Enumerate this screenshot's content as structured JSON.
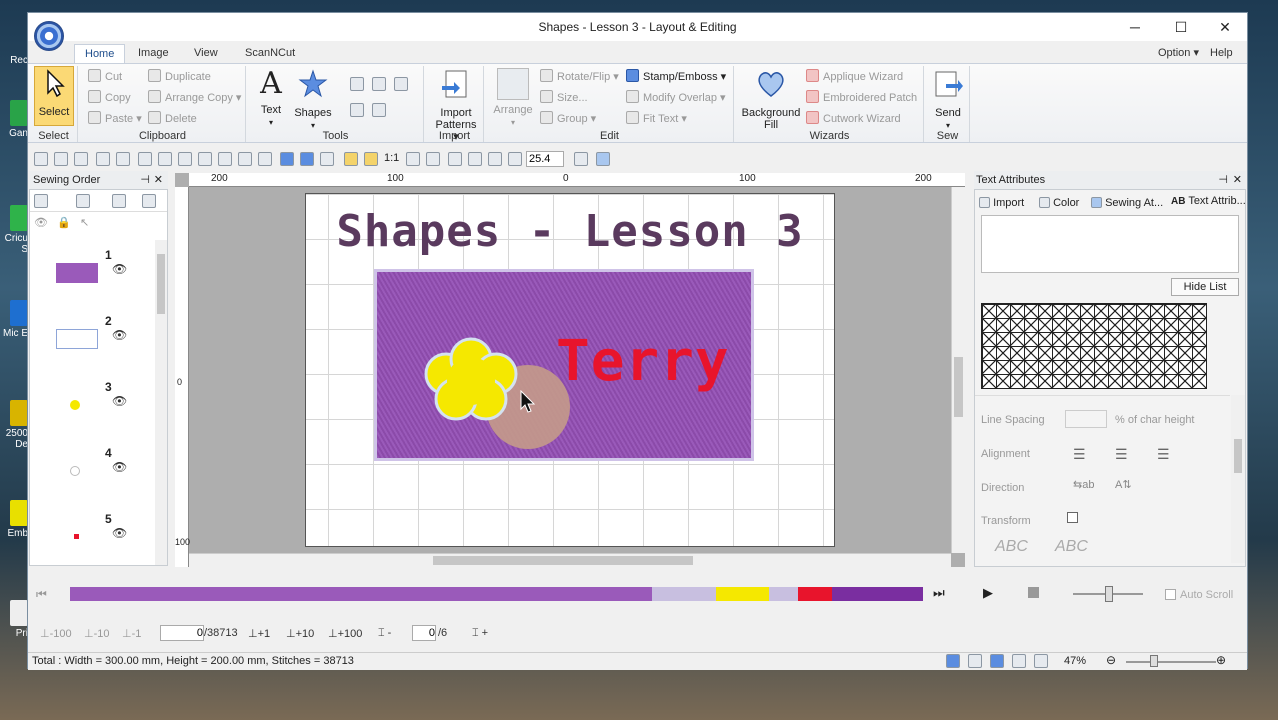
{
  "window": {
    "title": "Shapes - Lesson 3 - Layout & Editing",
    "minimize": "─",
    "maximize": "☐",
    "close": "✕"
  },
  "menu": {
    "tabs": [
      "Home",
      "Image",
      "View",
      "ScanNCut"
    ],
    "active_tab": "Home",
    "option": "Option",
    "help": "Help"
  },
  "ribbon": {
    "select": {
      "label": "Select",
      "group": "Select"
    },
    "clipboard": {
      "group": "Clipboard",
      "cut": "Cut",
      "copy": "Copy",
      "paste": "Paste",
      "duplicate": "Duplicate",
      "arrange_copy": "Arrange Copy",
      "delete": "Delete"
    },
    "tools": {
      "group": "Tools",
      "text": "Text",
      "shapes": "Shapes"
    },
    "import": {
      "group": "Import",
      "import_patterns": "Import Patterns"
    },
    "edit": {
      "group": "Edit",
      "arrange": "Arrange",
      "rotate_flip": "Rotate/Flip",
      "size": "Size...",
      "group_btn": "Group",
      "stamp_emboss": "Stamp/Emboss",
      "modify_overlap": "Modify Overlap",
      "fit_text": "Fit Text"
    },
    "wizards": {
      "group": "Wizards",
      "background_fill": "Background Fill",
      "applique_wizard": "Applique Wizard",
      "embroidered_patch": "Embroidered Patch",
      "cutwork_wizard": "Cutwork Wizard"
    },
    "sew": {
      "group": "Sew",
      "send": "Send"
    }
  },
  "toolbar": {
    "zoom_value": "25.4",
    "ratio": "1:1"
  },
  "sewing_order": {
    "title": "Sewing Order",
    "items": [
      {
        "num": "1",
        "color": "#9a5aba"
      },
      {
        "num": "2",
        "color": "#ffffff"
      },
      {
        "num": "3",
        "color": "#f5e800"
      },
      {
        "num": "4",
        "color": "#ffffff"
      },
      {
        "num": "5",
        "color": "#e8142c"
      }
    ]
  },
  "canvas": {
    "ruler_top": [
      "200",
      "100",
      "0",
      "100",
      "200"
    ],
    "ruler_left": [
      "0",
      "100"
    ],
    "design_title": "Shapes - Lesson 3",
    "name_text": "Terry"
  },
  "text_attributes": {
    "title": "Text Attributes",
    "tabs": [
      "Import",
      "Color",
      "Sewing At...",
      "Text Attrib..."
    ],
    "hide_list": "Hide List",
    "line_spacing_label": "Line Spacing",
    "char_height_label": "% of char height",
    "alignment_label": "Alignment",
    "direction_label": "Direction",
    "transform_label": "Transform"
  },
  "sequence": {
    "colors": [
      "#9a5aba",
      "#c8bfe0",
      "#f5e800",
      "#c8bfe0",
      "#e8142c",
      "#7a2ea0"
    ],
    "auto_scroll": "Auto Scroll"
  },
  "stitch_nav": {
    "minus100": "-100",
    "minus10": "-10",
    "minus1": "-1",
    "stitch_pos": "0",
    "stitch_total": "/38713",
    "plus1": "+1",
    "plus10": "+10",
    "plus100": "+100",
    "color_pos": "0",
    "color_total": "/6"
  },
  "status": {
    "text": "Total : Width = 300.00 mm, Height = 200.00 mm, Stitches = 38713",
    "zoom": "47%"
  },
  "desktop": {
    "icons": [
      "Rec",
      "Gan",
      "Cricu S",
      "Mic E",
      "2500 De",
      "Emb",
      "Pri"
    ]
  }
}
